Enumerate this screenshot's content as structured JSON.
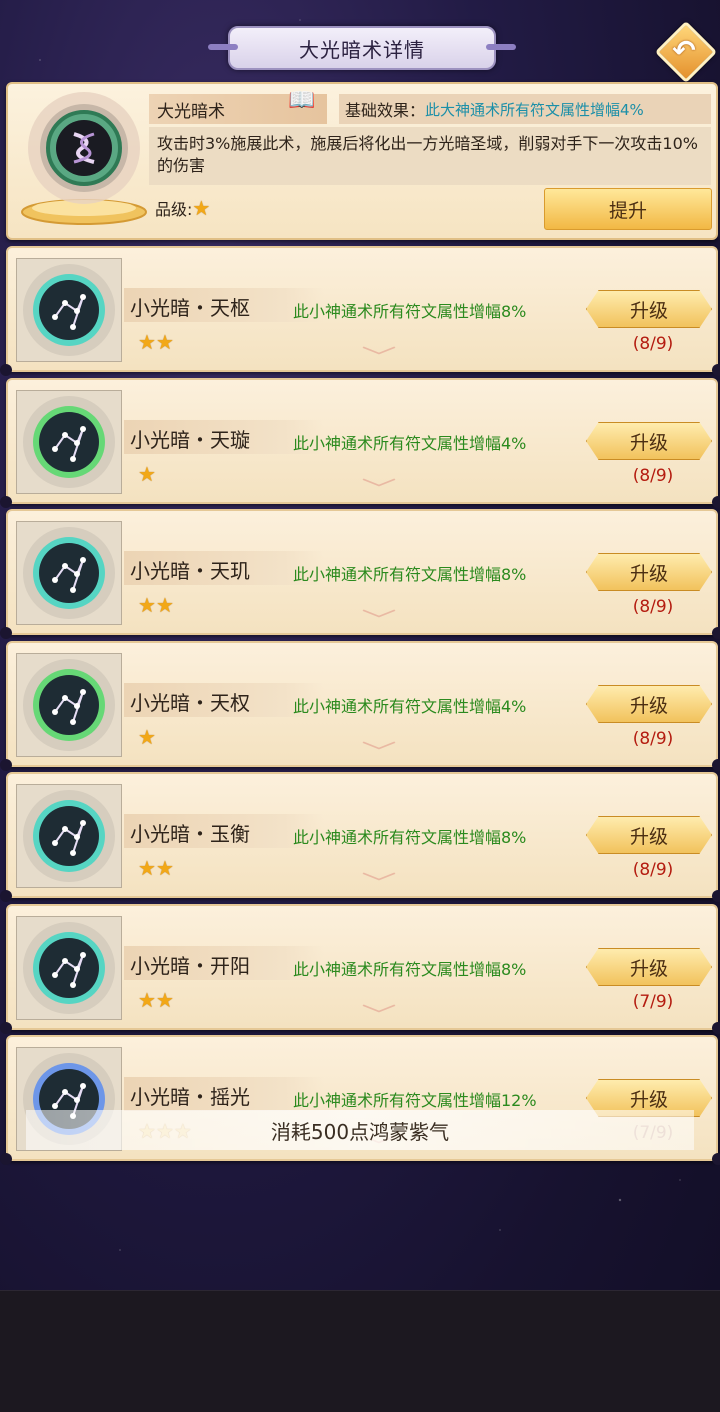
{
  "header": {
    "title": "大光暗术详情",
    "back_icon": "back-arrow-icon"
  },
  "main_skill": {
    "name": "大光暗术",
    "name_icon": "book-quill-icon",
    "effect_label": "基础效果：",
    "effect_value": "此大神通术所有符文属性增幅4%",
    "description": "攻击时3%施展此术，施展后将化出一方光暗圣域，削弱对手下一次攻击10%的伤害",
    "grade_label": "品级:",
    "grade_stars": 1,
    "upgrade_label": "提升",
    "colors": {
      "effect": "#1c8fa8",
      "star": "#f2a817"
    }
  },
  "runes": [
    {
      "name": "小光暗・天枢",
      "stars": 2,
      "effect": "此小神通术所有符文属性增幅8%",
      "button": "升级",
      "progress": "(8/9)",
      "glow": "#3fd6c4"
    },
    {
      "name": "小光暗・天璇",
      "stars": 1,
      "effect": "此小神通术所有符文属性增幅4%",
      "button": "升级",
      "progress": "(8/9)",
      "glow": "#52d96a"
    },
    {
      "name": "小光暗・天玑",
      "stars": 2,
      "effect": "此小神通术所有符文属性增幅8%",
      "button": "升级",
      "progress": "(8/9)",
      "glow": "#3fd6c4"
    },
    {
      "name": "小光暗・天权",
      "stars": 1,
      "effect": "此小神通术所有符文属性增幅4%",
      "button": "升级",
      "progress": "(8/9)",
      "glow": "#52d96a"
    },
    {
      "name": "小光暗・玉衡",
      "stars": 2,
      "effect": "此小神通术所有符文属性增幅8%",
      "button": "升级",
      "progress": "(8/9)",
      "glow": "#3fd6c4"
    },
    {
      "name": "小光暗・开阳",
      "stars": 2,
      "effect": "此小神通术所有符文属性增幅8%",
      "button": "升级",
      "progress": "(7/9)",
      "glow": "#3fd6c4"
    },
    {
      "name": "小光暗・摇光",
      "stars": 3,
      "effect": "此小神通术所有符文属性增幅12%",
      "button": "升级",
      "progress": "(7/9)",
      "glow": "#5a8cf0"
    }
  ],
  "toast": "消耗500点鸿蒙紫气"
}
